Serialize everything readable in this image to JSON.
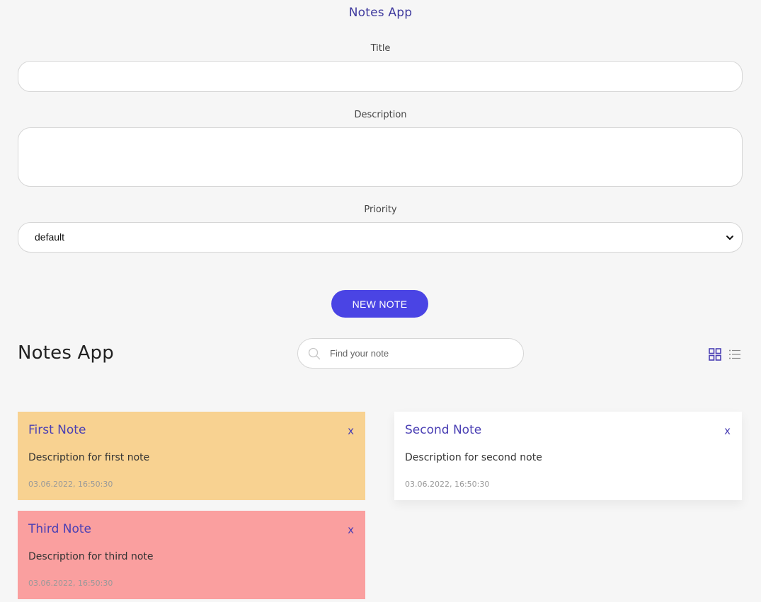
{
  "form": {
    "title": "Notes App",
    "title_label": "Title",
    "title_value": "",
    "description_label": "Description",
    "description_value": "",
    "priority_label": "Priority",
    "priority_value": "default",
    "submit_label": "NEW NOTE"
  },
  "list_header": {
    "title": "Notes App",
    "search_placeholder": "Find your note",
    "view_grid_icon": "grid-icon",
    "view_list_icon": "list-icon"
  },
  "notes": [
    {
      "title": "First Note",
      "description": "Description for first note",
      "date": "03.06.2022, 16:50:30",
      "color": "#f8d291",
      "close": "x"
    },
    {
      "title": "Second Note",
      "description": "Description for second note",
      "date": "03.06.2022, 16:50:30",
      "color": "#ffffff",
      "close": "x"
    },
    {
      "title": "Third Note",
      "description": "Description for third note",
      "date": "03.06.2022, 16:50:30",
      "color": "#fa9f9f",
      "close": "x"
    }
  ],
  "colors": {
    "accent": "#4a44e4",
    "title_text": "#3f3a9e"
  }
}
